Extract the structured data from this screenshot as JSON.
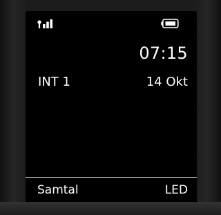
{
  "status_bar": {
    "signal_icon": "signal-strength-icon",
    "battery_icon": "battery-icon"
  },
  "idle_display": {
    "time": "07:15",
    "handset_name": "INT 1",
    "date": "14 Okt"
  },
  "softkeys": {
    "left_label": "Samtal",
    "right_label": "LED"
  },
  "colors": {
    "screen_background": "#000000",
    "text": "#ffffff",
    "divider": "#bfbfbf"
  }
}
